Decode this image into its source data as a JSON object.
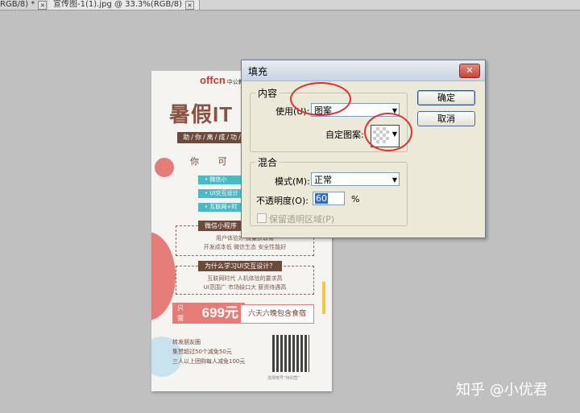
{
  "tabs": [
    {
      "label": "RGB/8) *"
    },
    {
      "label": "宣传图-1(1).jpg @ 33.3%(RGB/8)"
    }
  ],
  "poster": {
    "logo": "offcn",
    "logo_sub": "中公教",
    "headline": "暑假IT",
    "subbar": "助/你/离/成/功/",
    "diamonds": "你 可",
    "teal_items": [
      "• 微信小",
      "• UI交互设计",
      "• 互联网+时"
    ],
    "box1_title": "微信小程序",
    "box1_lines": [
      "用户体验好  流量获取易",
      "开发成本低  微信生态  安全性能好"
    ],
    "box2_title": "为什么学习UI交互设计？",
    "box2_lines": [
      "互联网时代  人机体验的要求高",
      "UI范围广  市场缺口大  薪资待遇高"
    ],
    "price_prefix": "只需",
    "price": "699元",
    "price_note": "六天六晚包含食宿",
    "friends": [
      "转发朋友圈",
      "集赞超过50个减免50元",
      "三人以上团购每人减免100元"
    ],
    "qr_caption": "选择暗号“特训营”"
  },
  "dialog": {
    "title": "填充",
    "close": "✕",
    "contents_legend": "内容",
    "use_label": "使用(U):",
    "use_value": "图案",
    "custom_pattern_label": "自定图案:",
    "ok": "确定",
    "cancel": "取消",
    "blend_legend": "混合",
    "mode_label": "模式(M):",
    "mode_value": "正常",
    "opacity_label": "不透明度(O):",
    "opacity_value": "60",
    "opacity_unit": "%",
    "preserve_label": "保留透明区域(P)"
  },
  "watermark": "知乎 @小优君",
  "colors": {
    "canvas_bg": "#c0c0c0",
    "dialog_bg": "#ece9d8",
    "highlight": "#e03030",
    "poster_pink": "#e47c77",
    "poster_teal": "#4bbac6",
    "poster_brown": "#6b4a3c"
  }
}
